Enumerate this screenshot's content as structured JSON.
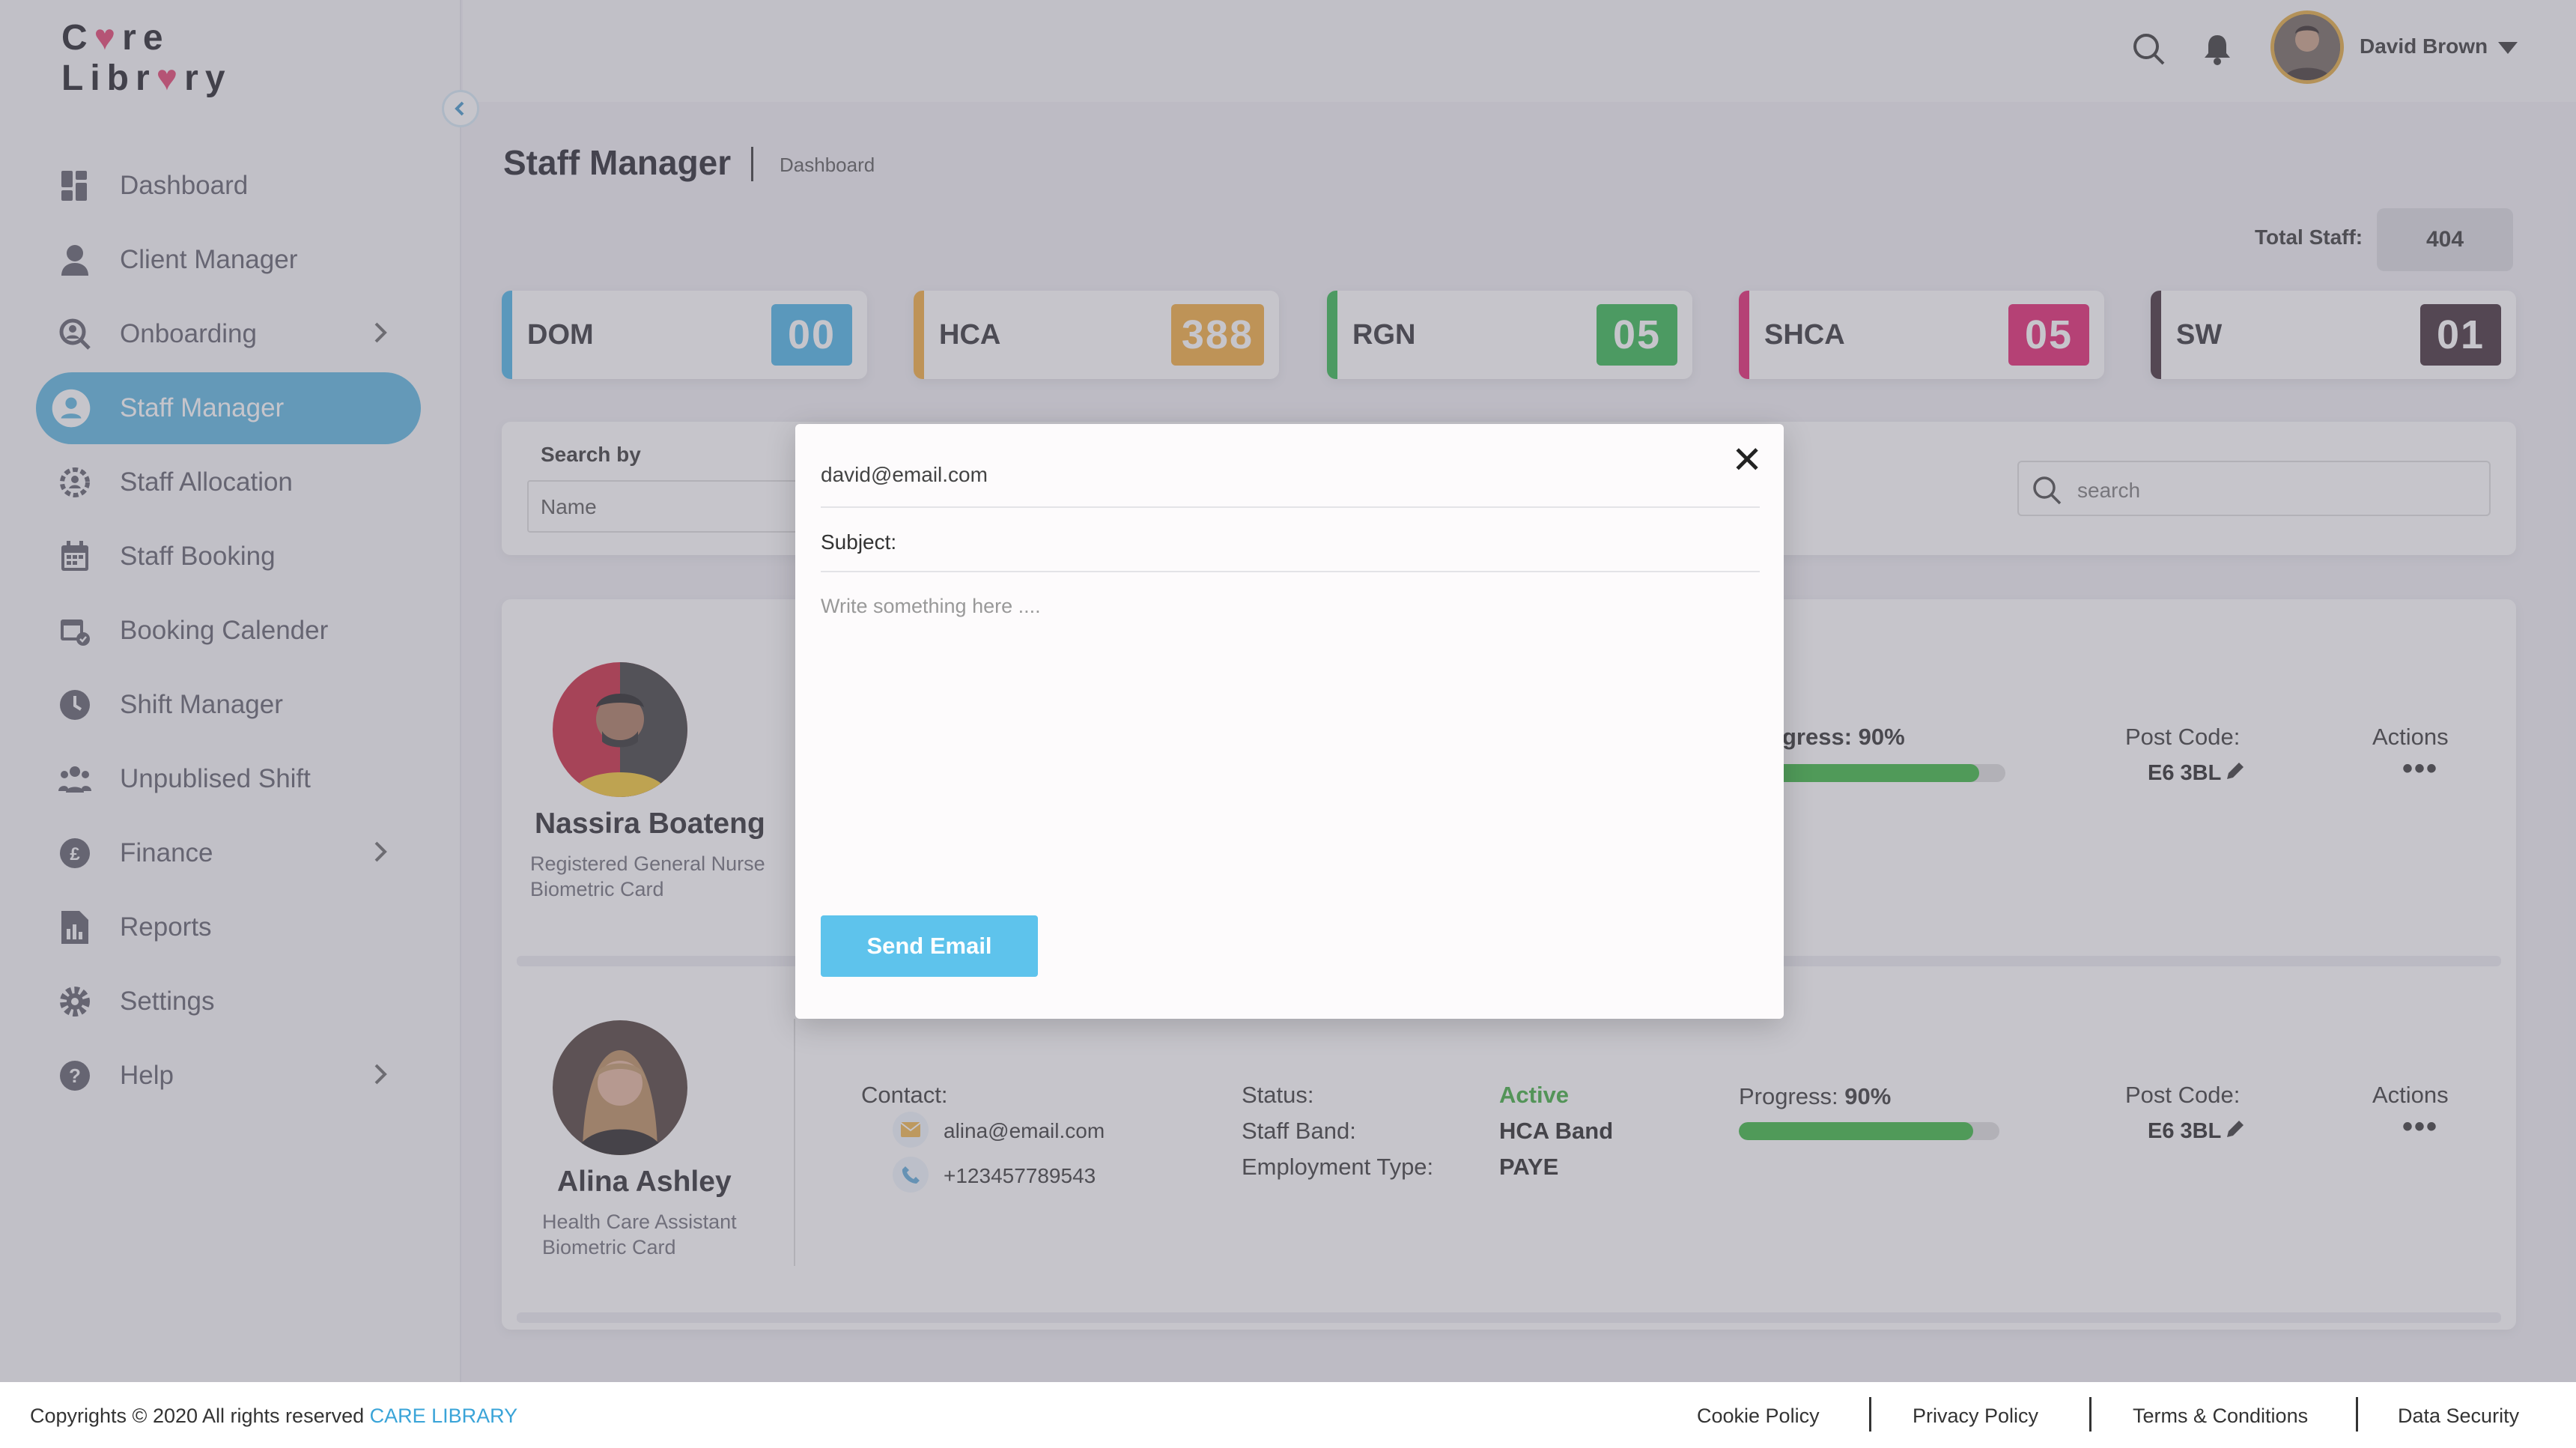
{
  "app": {
    "logo_line1": "Care",
    "logo_line2": "Librery"
  },
  "sidebar": {
    "items": [
      {
        "label": "Dashboard",
        "icon": "dashboard-icon"
      },
      {
        "label": "Client Manager",
        "icon": "user-icon"
      },
      {
        "label": "Onboarding",
        "icon": "onboarding-search-icon",
        "has_submenu": true
      },
      {
        "label": "Staff Manager",
        "icon": "staff-user-icon",
        "active": true
      },
      {
        "label": "Staff Allocation",
        "icon": "allocation-gear-icon"
      },
      {
        "label": "Staff Booking",
        "icon": "calendar-icon"
      },
      {
        "label": "Booking Calender",
        "icon": "calendar-check-icon"
      },
      {
        "label": "Shift Manager",
        "icon": "clock-icon"
      },
      {
        "label": "Unpublised Shift",
        "icon": "group-icon"
      },
      {
        "label": "Finance",
        "icon": "pound-icon",
        "has_submenu": true
      },
      {
        "label": "Reports",
        "icon": "report-icon"
      },
      {
        "label": "Settings",
        "icon": "gear-icon"
      },
      {
        "label": "Help",
        "icon": "help-icon",
        "has_submenu": true
      }
    ]
  },
  "header": {
    "user_name": "David Brown"
  },
  "page": {
    "title": "Staff Manager",
    "breadcrumb": "Dashboard",
    "total_label": "Total Staff:",
    "total_value": "404"
  },
  "stats": [
    {
      "label": "DOM",
      "value": "00",
      "color": "#45b2e6"
    },
    {
      "label": "HCA",
      "value": "388",
      "color": "#f1a937"
    },
    {
      "label": "RGN",
      "value": "05",
      "color": "#2db54a"
    },
    {
      "label": "SHCA",
      "value": "05",
      "color": "#e21d6b"
    },
    {
      "label": "SW",
      "value": "01",
      "color": "#3b2631"
    }
  ],
  "search": {
    "label": "Search by",
    "select_value": "Name",
    "placeholder": "search"
  },
  "staff": [
    {
      "name": "Nassira Boateng",
      "role": "Registered General Nurse",
      "doc": "Biometric Card",
      "progress_label": "Progress:",
      "progress_value": "90%",
      "progress": 0.9,
      "progress_visible_text": "gress: 90%",
      "postcode_label": "Post Code:",
      "postcode": "E6 3BL",
      "actions_label": "Actions"
    },
    {
      "name": "Alina Ashley",
      "role": "Health Care Assistant",
      "doc": "Biometric Card",
      "contact_label": "Contact:",
      "email": "alina@email.com",
      "phone": "+123457789543",
      "status_label": "Status:",
      "status": "Active",
      "band_label": "Staff Band:",
      "band": "HCA Band",
      "employment_label": "Employment Type:",
      "employment": "PAYE",
      "progress_label": "Progress:",
      "progress_value": "90%",
      "progress": 0.9,
      "postcode_label": "Post Code:",
      "postcode": "E6 3BL",
      "actions_label": "Actions"
    }
  ],
  "modal": {
    "to": "david@email.com",
    "subject_label": "Subject:",
    "body_placeholder": "Write something here ....",
    "send_label": "Send Email",
    "close_symbol": "✕"
  },
  "footer": {
    "copyright": "Copyrights © 2020  All rights reserved",
    "brand": "CARE LIBRARY",
    "links": [
      "Cookie Policy",
      "Privacy Policy",
      "Terms & Conditions",
      "Data Security"
    ]
  }
}
